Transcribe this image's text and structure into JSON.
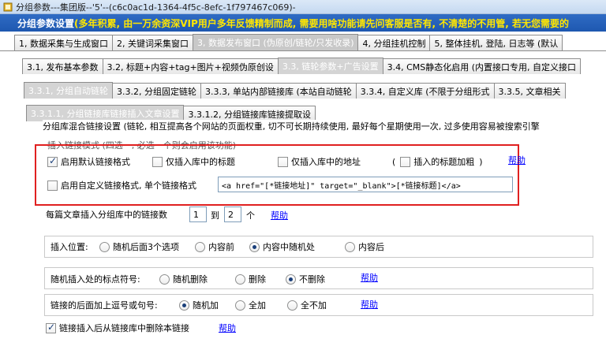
{
  "window": {
    "title": "分组参数---集团版--'5'--(c6c0ac1d-1364-4f5c-8efc-1f797467c069)-"
  },
  "banner": {
    "prefix": "分组参数设置",
    "message": "(多年积累, 由一万余资深VIP用户多年反馈精制而成, 需要用啥功能请先问客服是否有, 不清楚的不用管, 若无您需要的"
  },
  "tabs_level1": [
    {
      "label": "1, 数据采集与生成窗口"
    },
    {
      "label": "2, 关键词采集窗口"
    },
    {
      "label": "3, 数据发布窗口 (伪原创/链轮/只发收录)"
    },
    {
      "label": "4, 分组挂机控制"
    },
    {
      "label": "5, 整体挂机, 登陆, 日志等 (默认"
    }
  ],
  "tabs_level2": [
    {
      "label": "3.1, 发布基本参数"
    },
    {
      "label": "3.2, 标题+内容+tag+图片+视频伪原创设"
    },
    {
      "label": "3.3, 链轮参数+广告设置"
    },
    {
      "label": "3.4, CMS静态化启用 (内置接口专用, 自定义接口"
    }
  ],
  "tabs_level3": [
    {
      "label": "3.3.1, 分组自动链轮"
    },
    {
      "label": "3.3.2, 分组固定链轮"
    },
    {
      "label": "3.3.3, 单站内部链接库 (本站自动链轮"
    },
    {
      "label": "3.3.4, 自定义库 (不限于分组形式"
    },
    {
      "label": "3.3.5, 文章相关"
    }
  ],
  "tabs_level4": [
    {
      "label": "3.3.1.1, 分组链接库链接插入文章设置"
    },
    {
      "label": "3.3.1.2, 分组链接库链接提取设"
    }
  ],
  "groupbox": {
    "title": "分组库混合链接设置 (链轮, 相互提高各个网站的页面权重, 切不可长期持续使用, 最好每个星期使用一次, 过多使用容易被搜索引擎",
    "hint": "插入链接模式 (四选一, 必选一个则会启用该功能)"
  },
  "link_mode": {
    "opt_default_format": "启用默认链接格式",
    "opt_title_only": "仅插入库中的标题",
    "opt_url_only": "仅插入库中的地址",
    "paren_open": "(",
    "opt_bold_title": "插入的标题加粗",
    "paren_close": ")",
    "help": "帮助",
    "opt_custom_format": "启用自定义链接格式, 单个链接格式",
    "custom_format_value": "<a href=\"[*链接地址]\" target=\"_blank\">[*链接标题]</a>"
  },
  "count": {
    "label": "每篇文章插入分组库中的链接数",
    "min": "1",
    "to": "到",
    "max": "2",
    "unit": "个",
    "help": "帮助"
  },
  "position": {
    "label": "插入位置:",
    "opt1": "随机后面3个选项",
    "opt2": "内容前",
    "opt3": "内容中随机处",
    "opt4": "内容后"
  },
  "punctuation": {
    "label": "随机插入处的标点符号:",
    "opt1": "随机删除",
    "opt2": "删除",
    "opt3": "不删除",
    "help": "帮助"
  },
  "comma": {
    "label": "链接的后面加上逗号或句号:",
    "opt1": "随机加",
    "opt2": "全加",
    "opt3": "全不加",
    "help": "帮助"
  },
  "remove_after": {
    "label": "链接插入后从链接库中删除本链接",
    "help": "帮助"
  },
  "colors": {
    "banner_bg": "#1e58b0",
    "banner_text": "#ffe600",
    "highlight_box": "#e02020",
    "link": "#0000ff"
  }
}
